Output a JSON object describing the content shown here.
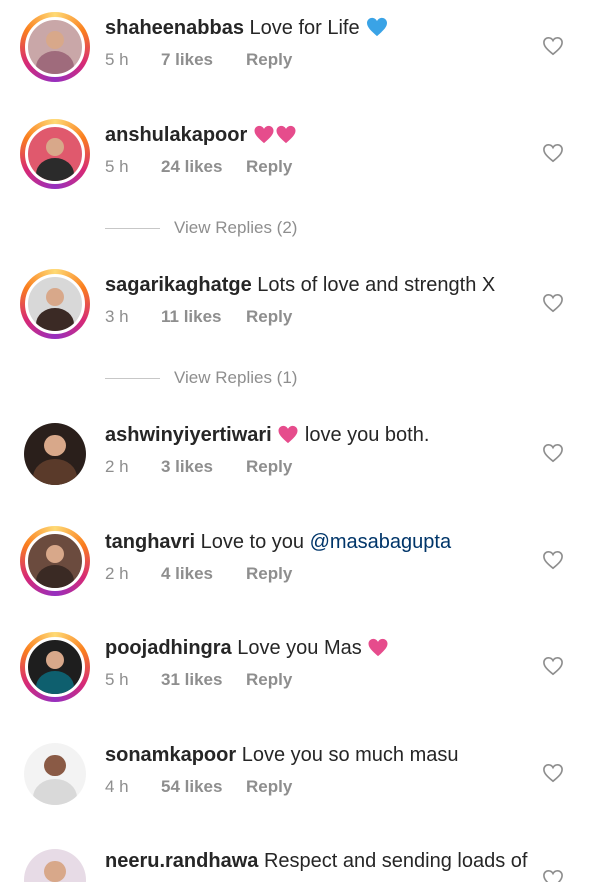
{
  "comments": [
    {
      "username": "shaheenabbas",
      "text": "Love for Life",
      "emoji": "blue-heart",
      "time": "5 h",
      "likes": "7 likes",
      "reply": "Reply",
      "ring": true,
      "bg": "#c9a7a8",
      "cloth": "#9f6b7c"
    },
    {
      "username": "anshulakapoor",
      "text": "",
      "emoji": "two-pink-hearts",
      "time": "5 h",
      "likes": "24 likes",
      "reply": "Reply",
      "ring": true,
      "bg": "#e0596d",
      "cloth": "#2b2b2b"
    },
    {
      "username": "sagarikaghatge",
      "text": "Lots of love and strength X",
      "emoji": "",
      "time": "3 h",
      "likes": "11 likes",
      "reply": "Reply",
      "ring": true,
      "bg": "#d8d8d8",
      "cloth": "#3b2a25"
    },
    {
      "username": "ashwinyiyertiwari",
      "text": "love you both.",
      "emoji": "pink-heart-inline",
      "time": "2 h",
      "likes": "3 likes",
      "reply": "Reply",
      "ring": false,
      "bg": "#2a1f1b",
      "cloth": "#5a3a2a"
    },
    {
      "username": "tanghavri",
      "text": "Love to you",
      "mention": "@masabagupta",
      "emoji": "",
      "time": "2 h",
      "likes": "4 likes",
      "reply": "Reply",
      "ring": true,
      "bg": "#6b4b3e",
      "cloth": "#3a2a24"
    },
    {
      "username": "poojadhingra",
      "text": "Love you Mas",
      "emoji": "pink-heart",
      "time": "5 h",
      "likes": "31 likes",
      "reply": "Reply",
      "ring": true,
      "bg": "#1e1e1e",
      "cloth": "#0e5f6e"
    },
    {
      "username": "sonamkapoor",
      "text": "Love you so much masu",
      "emoji": "",
      "time": "4 h",
      "likes": "54 likes",
      "reply": "Reply",
      "ring": false,
      "bg": "#f3f3f3",
      "cloth": "#d9d9d9"
    },
    {
      "username": "neeru.randhawa",
      "text": "Respect and sending loads of",
      "emoji": "",
      "time": "",
      "likes": "",
      "reply": "",
      "ring": false,
      "bg": "#e7dbe6",
      "cloth": "#b788b0"
    }
  ],
  "view_replies": [
    {
      "label": "View Replies (2)"
    },
    {
      "label": "View Replies (1)"
    }
  ],
  "colors": {
    "pink_heart": "#e64c8c",
    "blue_heart": "#3aa3e6",
    "muted": "#8e8e8e",
    "mention": "#003569"
  }
}
